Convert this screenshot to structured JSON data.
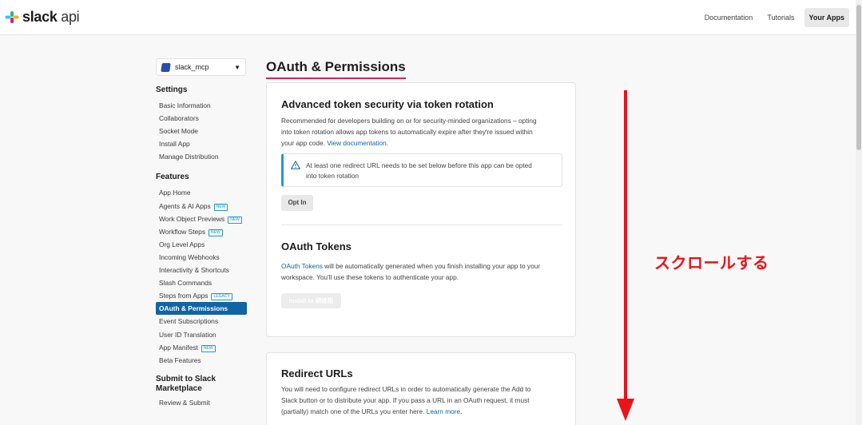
{
  "header": {
    "logo_bold": "slack",
    "logo_light": " api",
    "nav": [
      "Documentation",
      "Tutorials",
      "Your Apps"
    ]
  },
  "sidebar": {
    "app_name": "slack_mcp",
    "settings_heading": "Settings",
    "settings_items": [
      "Basic Information",
      "Collaborators",
      "Socket Mode",
      "Install App",
      "Manage Distribution"
    ],
    "features_heading": "Features",
    "feature_items": [
      {
        "label": "App Home",
        "tag": ""
      },
      {
        "label": "Agents & AI Apps",
        "tag": "NEW"
      },
      {
        "label": "Work Object Previews",
        "tag": "NEW"
      },
      {
        "label": "Workflow Steps",
        "tag": "NEW"
      },
      {
        "label": "Org Level Apps",
        "tag": ""
      },
      {
        "label": "Incoming Webhooks",
        "tag": ""
      },
      {
        "label": "Interactivity & Shortcuts",
        "tag": ""
      },
      {
        "label": "Slash Commands",
        "tag": ""
      },
      {
        "label": "Steps from Apps",
        "tag": "LEGACY"
      },
      {
        "label": "OAuth & Permissions",
        "tag": "",
        "active": true
      },
      {
        "label": "Event Subscriptions",
        "tag": ""
      },
      {
        "label": "User ID Translation",
        "tag": ""
      },
      {
        "label": "App Manifest",
        "tag": "NEW"
      },
      {
        "label": "Beta Features",
        "tag": ""
      }
    ],
    "marketplace_heading_1": "Submit to Slack",
    "marketplace_heading_2": "Marketplace",
    "marketplace_items": [
      "Review & Submit"
    ]
  },
  "main": {
    "title": "OAuth & Permissions",
    "rotation": {
      "heading": "Advanced token security via token rotation",
      "desc_1": "Recommended for developers building on or for security-minded organizations – opting",
      "desc_2": "into token rotation allows app tokens to automatically expire after they're issued within",
      "desc_3": "your app code. ",
      "desc_link": "View documentation",
      "desc_end": ".",
      "alert_1": "At least one redirect URL needs to be set below before this app can be opted",
      "alert_2": "into token rotation",
      "opt_in_button": "Opt In"
    },
    "tokens": {
      "heading": "OAuth Tokens",
      "link": "OAuth Tokens",
      "desc_1": " will be automatically generated when you finish installing your app to your",
      "desc_2": "workspace. You'll use these tokens to authenticate your app.",
      "install_button": "Install to 研修用"
    },
    "redirect": {
      "heading": "Redirect URLs",
      "desc_1": "You will need to configure redirect URLs in order to automatically generate the Add to",
      "desc_2": "Slack button or to distribute your app. If you pass a URL in an OAuth request, it must",
      "desc_3": "(partially) match one of the URLs you enter here. ",
      "link": "Learn more",
      "desc_end": "."
    }
  },
  "annotation": {
    "text": "スクロールする",
    "color": "#e8141a"
  },
  "colors": {
    "accent_active": "#1264a3",
    "title_underline": "#e01e5a",
    "alert_border": "#1d9bd1"
  }
}
